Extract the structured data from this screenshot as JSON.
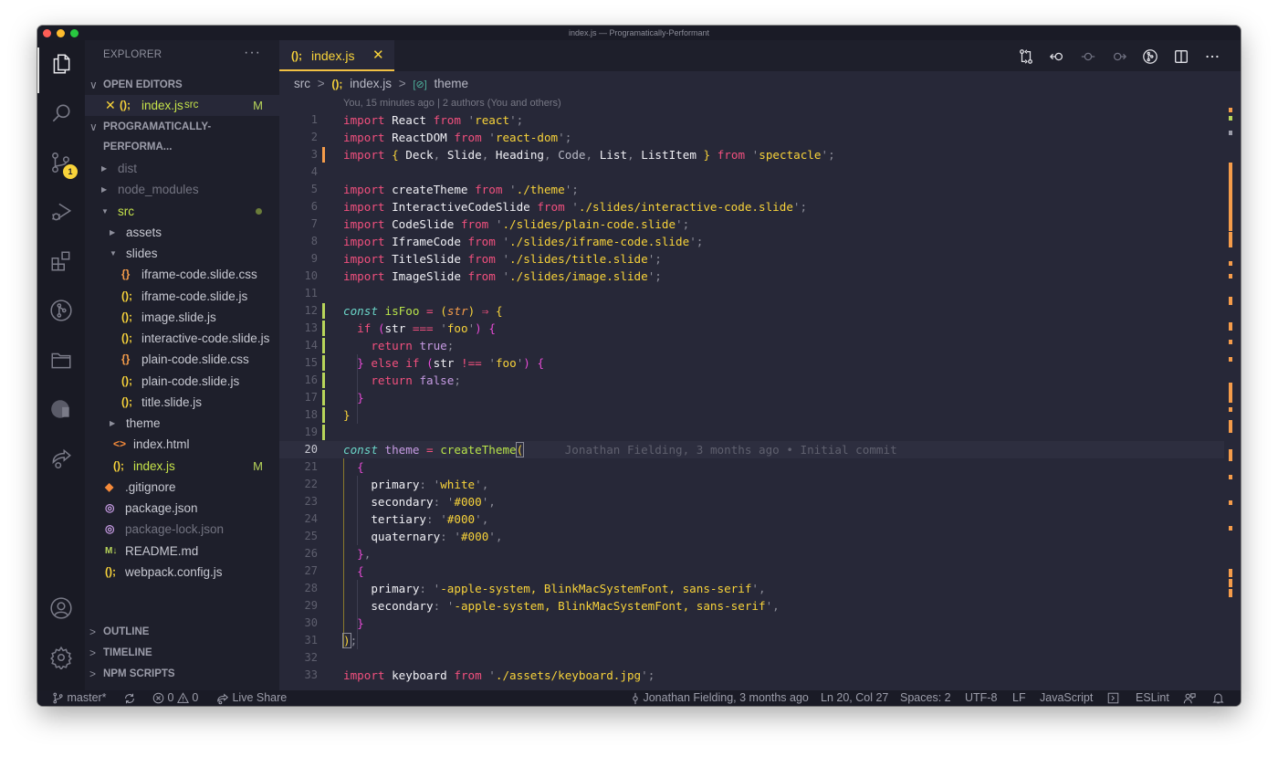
{
  "window": {
    "title": "index.js — Programatically-Performant"
  },
  "activity_bar": {
    "items": [
      {
        "name": "explorer",
        "icon": "files-icon",
        "active": true
      },
      {
        "name": "search",
        "icon": "search-icon"
      },
      {
        "name": "source-control",
        "icon": "source-control-icon",
        "badge": "1"
      },
      {
        "name": "run-debug",
        "icon": "debug-icon"
      },
      {
        "name": "extensions",
        "icon": "extensions-icon"
      },
      {
        "name": "gitlens",
        "icon": "gitlens-icon"
      },
      {
        "name": "project-manager",
        "icon": "folder-icon"
      },
      {
        "name": "remote-explorer",
        "icon": "remote-icon"
      },
      {
        "name": "live-share",
        "icon": "live-share-icon"
      }
    ],
    "bottom": [
      {
        "name": "accounts",
        "icon": "account-icon"
      },
      {
        "name": "manage",
        "icon": "gear-icon"
      }
    ]
  },
  "sidebar": {
    "header": "EXPLORER",
    "more": "···",
    "open_editors": {
      "label": "OPEN EDITORS",
      "items": [
        {
          "close": "✕",
          "icon": "();",
          "name": "index.js",
          "folder": "src",
          "status": "M"
        }
      ]
    },
    "project": {
      "label": "PROGRAMATICALLY-PERFORMA...",
      "tree": [
        {
          "name": "dist",
          "type": "folder",
          "expanded": false,
          "depth": 0,
          "dim": true
        },
        {
          "name": "node_modules",
          "type": "folder",
          "expanded": false,
          "depth": 0,
          "dim": true
        },
        {
          "name": "src",
          "type": "folder",
          "expanded": true,
          "depth": 0,
          "modified_dot": true
        },
        {
          "name": "assets",
          "type": "folder",
          "expanded": false,
          "depth": 1
        },
        {
          "name": "slides",
          "type": "folder",
          "expanded": true,
          "depth": 1
        },
        {
          "name": "iframe-code.slide.css",
          "type": "css",
          "icon": "{}",
          "depth": 2
        },
        {
          "name": "iframe-code.slide.js",
          "type": "js",
          "icon": "();",
          "depth": 2
        },
        {
          "name": "image.slide.js",
          "type": "js",
          "icon": "();",
          "depth": 2
        },
        {
          "name": "interactive-code.slide.js",
          "type": "js",
          "icon": "();",
          "depth": 2
        },
        {
          "name": "plain-code.slide.css",
          "type": "css",
          "icon": "{}",
          "depth": 2
        },
        {
          "name": "plain-code.slide.js",
          "type": "js",
          "icon": "();",
          "depth": 2
        },
        {
          "name": "title.slide.js",
          "type": "js",
          "icon": "();",
          "depth": 2
        },
        {
          "name": "theme",
          "type": "folder",
          "expanded": false,
          "depth": 1
        },
        {
          "name": "index.html",
          "type": "html",
          "icon": "<>",
          "depth": 1
        },
        {
          "name": "index.js",
          "type": "js",
          "icon": "();",
          "depth": 1,
          "status": "M",
          "modified": true
        },
        {
          "name": ".gitignore",
          "type": "git",
          "icon": "◆",
          "depth": 0
        },
        {
          "name": "package.json",
          "type": "json",
          "icon": "◎",
          "depth": 0
        },
        {
          "name": "package-lock.json",
          "type": "json",
          "icon": "◎",
          "depth": 0,
          "dim": true
        },
        {
          "name": "README.md",
          "type": "md",
          "icon": "M↓",
          "depth": 0
        },
        {
          "name": "webpack.config.js",
          "type": "js",
          "icon": "();",
          "depth": 0
        }
      ]
    },
    "sections": [
      {
        "label": "OUTLINE"
      },
      {
        "label": "TIMELINE"
      },
      {
        "label": "NPM SCRIPTS"
      }
    ]
  },
  "editor": {
    "tab": {
      "icon": "();",
      "label": "index.js",
      "close": "✕"
    },
    "actions": [
      {
        "name": "open-changes",
        "icon": "compare-changes-icon"
      },
      {
        "name": "previous-revision",
        "icon": "previous-revision-icon"
      },
      {
        "name": "commit-details",
        "icon": "commit-icon"
      },
      {
        "name": "next-revision",
        "icon": "next-revision-icon"
      },
      {
        "name": "gitlens",
        "icon": "gitlens-icon"
      },
      {
        "name": "split-editor",
        "icon": "split-editor-icon"
      },
      {
        "name": "more-actions",
        "icon": "more-icon"
      }
    ],
    "breadcrumb": {
      "folder": "src",
      "file_icon": "();",
      "file": "index.js",
      "symbol_icon": "[⊘]",
      "symbol": "theme",
      "separator": ">"
    },
    "codelens": "You, 15 minutes ago | 2 authors (You and others)",
    "current_line_blame": "Jonathan Fielding, 3 months ago • Initial commit",
    "lines": [
      {
        "n": "1"
      },
      {
        "n": "2"
      },
      {
        "n": "3"
      },
      {
        "n": "4"
      },
      {
        "n": "5"
      },
      {
        "n": "6"
      },
      {
        "n": "7"
      },
      {
        "n": "8"
      },
      {
        "n": "9"
      },
      {
        "n": "10"
      },
      {
        "n": "11"
      },
      {
        "n": "12"
      },
      {
        "n": "13"
      },
      {
        "n": "14"
      },
      {
        "n": "15"
      },
      {
        "n": "16"
      },
      {
        "n": "17"
      },
      {
        "n": "18"
      },
      {
        "n": "19"
      },
      {
        "n": "20"
      },
      {
        "n": "21"
      },
      {
        "n": "22"
      },
      {
        "n": "23"
      },
      {
        "n": "24"
      },
      {
        "n": "25"
      },
      {
        "n": "26"
      },
      {
        "n": "27"
      },
      {
        "n": "28"
      },
      {
        "n": "29"
      },
      {
        "n": "30"
      },
      {
        "n": "31"
      },
      {
        "n": "32"
      },
      {
        "n": "33"
      }
    ],
    "tokens": {
      "import": "import",
      "from": "from",
      "const": "const",
      "if": "if",
      "else": "else",
      "return": "return",
      "true": "true",
      "false": "false",
      "React": "React",
      "react": "react",
      "ReactDOM": "ReactDOM",
      "react_dom": "react-dom",
      "Deck": "Deck",
      "Slide": "Slide",
      "Heading": "Heading",
      "Code": "Code",
      "List": "List",
      "ListItem": "ListItem",
      "spectacle": "spectacle",
      "createTheme": "createTheme",
      "theme_path": "./theme",
      "InteractiveCodeSlide": "InteractiveCodeSlide",
      "interactive_path": "./slides/interactive-code.slide",
      "CodeSlide": "CodeSlide",
      "plain_path": "./slides/plain-code.slide",
      "IframeCode": "IframeCode",
      "iframe_path": "./slides/iframe-code.slide",
      "TitleSlide": "TitleSlide",
      "title_path": "./slides/title.slide",
      "ImageSlide": "ImageSlide",
      "image_path": "./slides/image.slide",
      "isFoo": "isFoo",
      "str": "str",
      "foo": "foo",
      "strict_eq": "===",
      "strict_neq": "!==",
      "arrow": "⇒",
      "theme": "theme",
      "primary": "primary",
      "secondary": "secondary",
      "tertiary": "tertiary",
      "quaternary": "quaternary",
      "white": "white",
      "black": "#000",
      "font_stack": "-apple-system, BlinkMacSystemFont, sans-serif",
      "keyboard": "keyboard",
      "keyboard_path": "./assets/keyboard.jpg"
    }
  },
  "statusbar": {
    "branch": "master*",
    "sync_icon": "sync-icon",
    "errors": "0",
    "warnings": "0",
    "live_share": "Live Share",
    "blame": "Jonathan Fielding, 3 months ago",
    "position": "Ln 20, Col 27",
    "spaces": "Spaces: 2",
    "encoding": "UTF-8",
    "eol": "LF",
    "language": "JavaScript",
    "eslint": "ESLint"
  },
  "colors": {
    "accent": "#f8d33a",
    "modified": "#f59c4a",
    "added": "#b8d55a",
    "keyword": "#f2507e",
    "string": "#f8d33a",
    "background": "#272838",
    "sidebar": "#1e1f2b"
  }
}
